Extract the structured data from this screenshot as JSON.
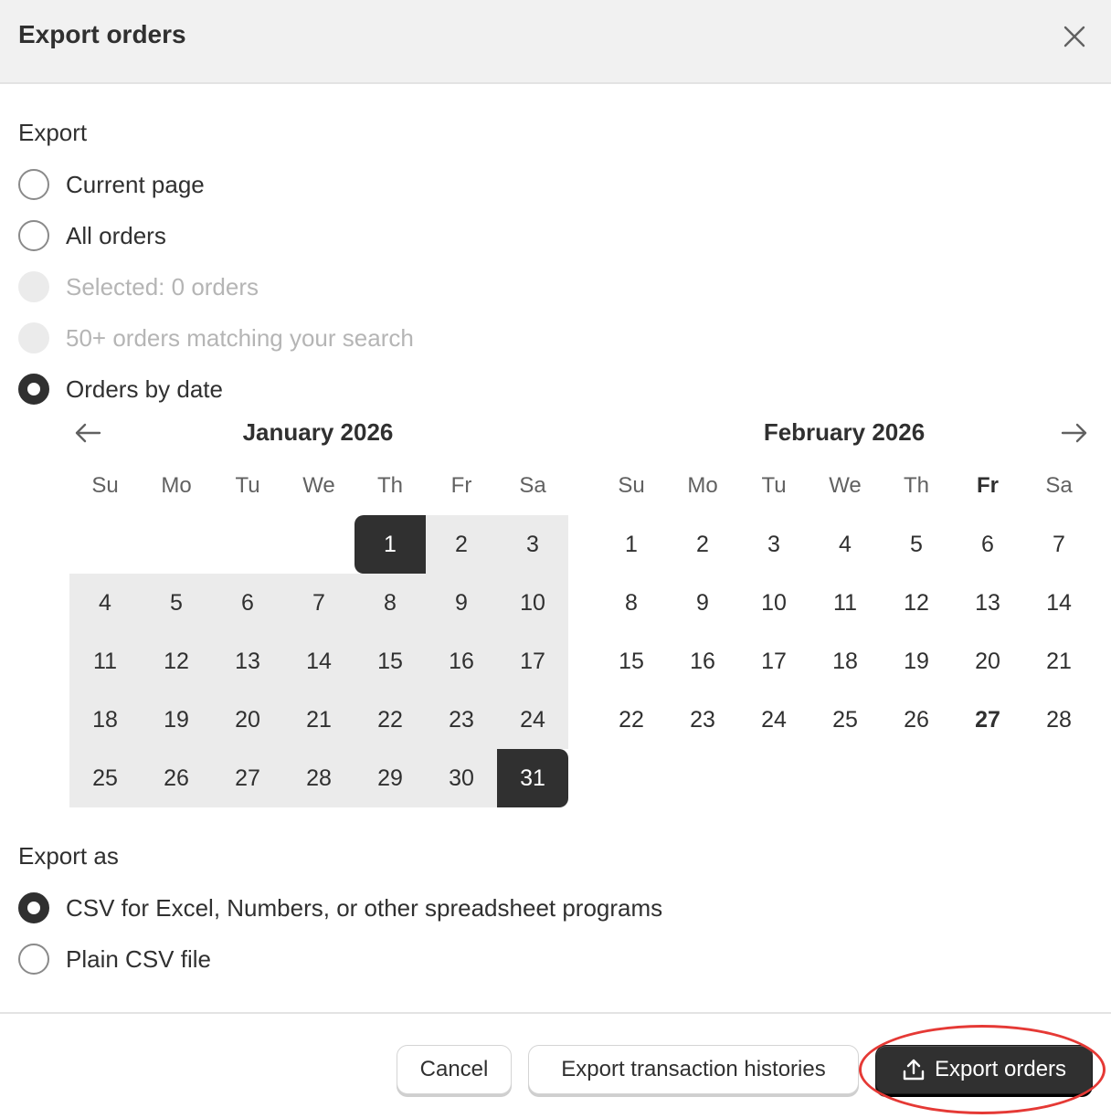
{
  "header": {
    "title": "Export orders",
    "close_icon": "close-icon"
  },
  "export": {
    "label": "Export",
    "options": [
      {
        "label": "Current page",
        "state": "unchecked"
      },
      {
        "label": "All orders",
        "state": "unchecked"
      },
      {
        "label": "Selected: 0 orders",
        "state": "disabled"
      },
      {
        "label": "50+ orders matching your search",
        "state": "disabled"
      },
      {
        "label": "Orders by date",
        "state": "checked"
      }
    ]
  },
  "calendar": {
    "prev_icon": "arrow-left-icon",
    "next_icon": "arrow-right-icon",
    "weekdays": [
      "Su",
      "Mo",
      "Tu",
      "We",
      "Th",
      "Fr",
      "Sa"
    ],
    "months": [
      {
        "title": "January 2026",
        "first_weekday": 4,
        "days_in_month": 31,
        "range_start": 1,
        "range_end": 31,
        "today": null
      },
      {
        "title": "February 2026",
        "first_weekday": 0,
        "days_in_month": 28,
        "range_start": null,
        "range_end": null,
        "today": 27,
        "today_weekday": 5
      }
    ]
  },
  "export_as": {
    "label": "Export as",
    "options": [
      {
        "label": "CSV for Excel, Numbers, or other spreadsheet programs",
        "state": "checked"
      },
      {
        "label": "Plain CSV file",
        "state": "unchecked"
      }
    ]
  },
  "footer": {
    "cancel_label": "Cancel",
    "transactions_label": "Export transaction histories",
    "export_label": "Export orders",
    "export_icon": "upload-icon"
  },
  "colors": {
    "primary": "#303030",
    "range_bg": "#ebebeb",
    "highlight": "#e53935"
  }
}
